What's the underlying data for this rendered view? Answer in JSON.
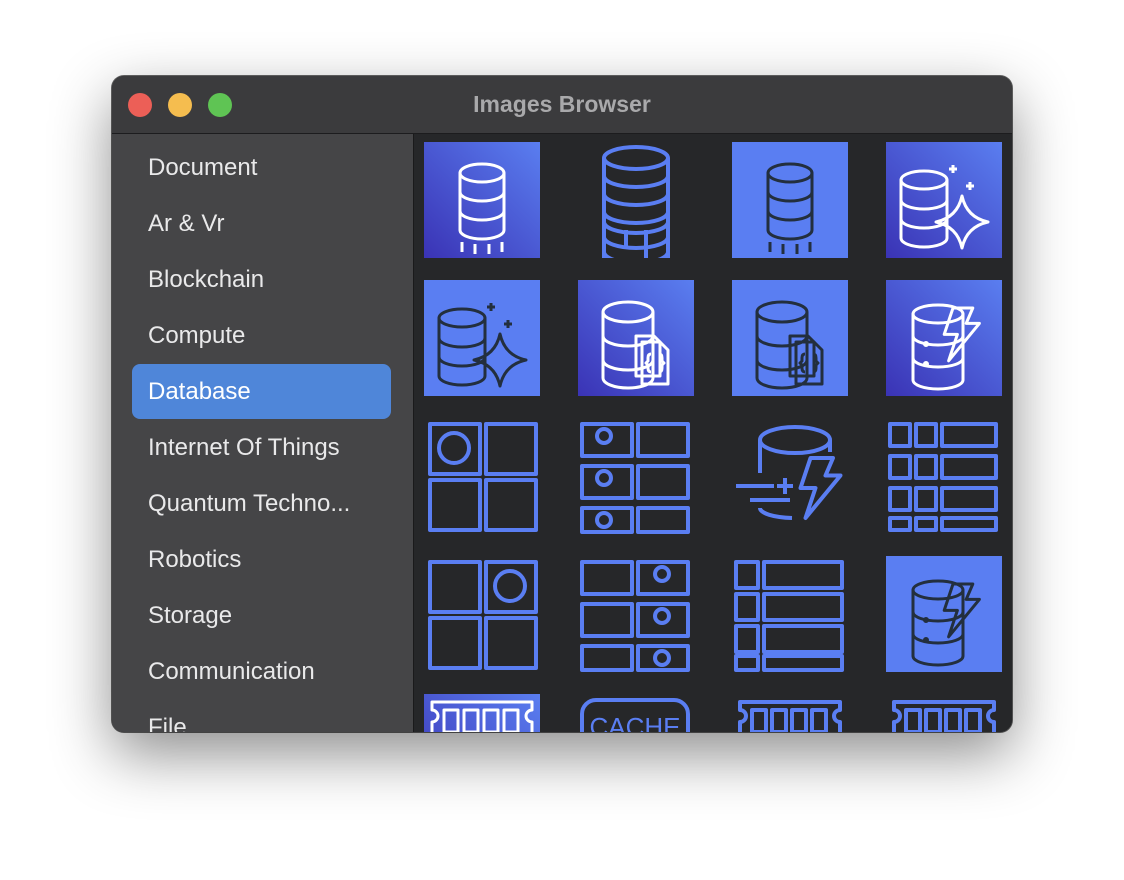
{
  "window": {
    "title": "Images Browser"
  },
  "colors": {
    "accent": "#4f86d9",
    "icon_blue": "#5a7ef2",
    "gradient_dark": "#3a33b5",
    "gradient_light": "#5a7ef0",
    "icon_dark": "#232f3e"
  },
  "sidebar": {
    "selected_index": 4,
    "items": [
      {
        "label": "Document"
      },
      {
        "label": "Ar & Vr"
      },
      {
        "label": "Blockchain"
      },
      {
        "label": "Compute"
      },
      {
        "label": "Database"
      },
      {
        "label": "Internet Of Things"
      },
      {
        "label": "Quantum Techno..."
      },
      {
        "label": "Robotics"
      },
      {
        "label": "Storage"
      },
      {
        "label": "Communication"
      },
      {
        "label": "File"
      }
    ]
  },
  "grid": {
    "tiles": [
      {
        "icon": "database-throughput-icon",
        "style": "gradient"
      },
      {
        "icon": "database-rack-icon",
        "style": "plain"
      },
      {
        "icon": "database-throughput-icon",
        "style": "flat"
      },
      {
        "icon": "database-sparkle-icon",
        "style": "gradient"
      },
      {
        "icon": "database-sparkle-icon",
        "style": "flat"
      },
      {
        "icon": "database-document-icon",
        "style": "gradient"
      },
      {
        "icon": "database-document-icon",
        "style": "flat"
      },
      {
        "icon": "database-lightning-icon",
        "style": "gradient"
      },
      {
        "icon": "grid-circle-top-left-icon",
        "style": "plain"
      },
      {
        "icon": "table-circles-left-icon",
        "style": "plain"
      },
      {
        "icon": "cache-lightning-icon",
        "style": "plain"
      },
      {
        "icon": "table-grid-icon",
        "style": "plain"
      },
      {
        "icon": "grid-circle-top-right-icon",
        "style": "plain"
      },
      {
        "icon": "table-circles-right-icon",
        "style": "plain"
      },
      {
        "icon": "table-list-icon",
        "style": "plain"
      },
      {
        "icon": "database-lightning-icon",
        "style": "flat"
      },
      {
        "icon": "memory-module-icon",
        "style": "gradient"
      },
      {
        "icon": "cache-label-icon",
        "style": "plain",
        "label": "CACHE"
      },
      {
        "icon": "memory-module-icon",
        "style": "plain"
      },
      {
        "icon": "memory-module-icon",
        "style": "plain"
      }
    ]
  }
}
